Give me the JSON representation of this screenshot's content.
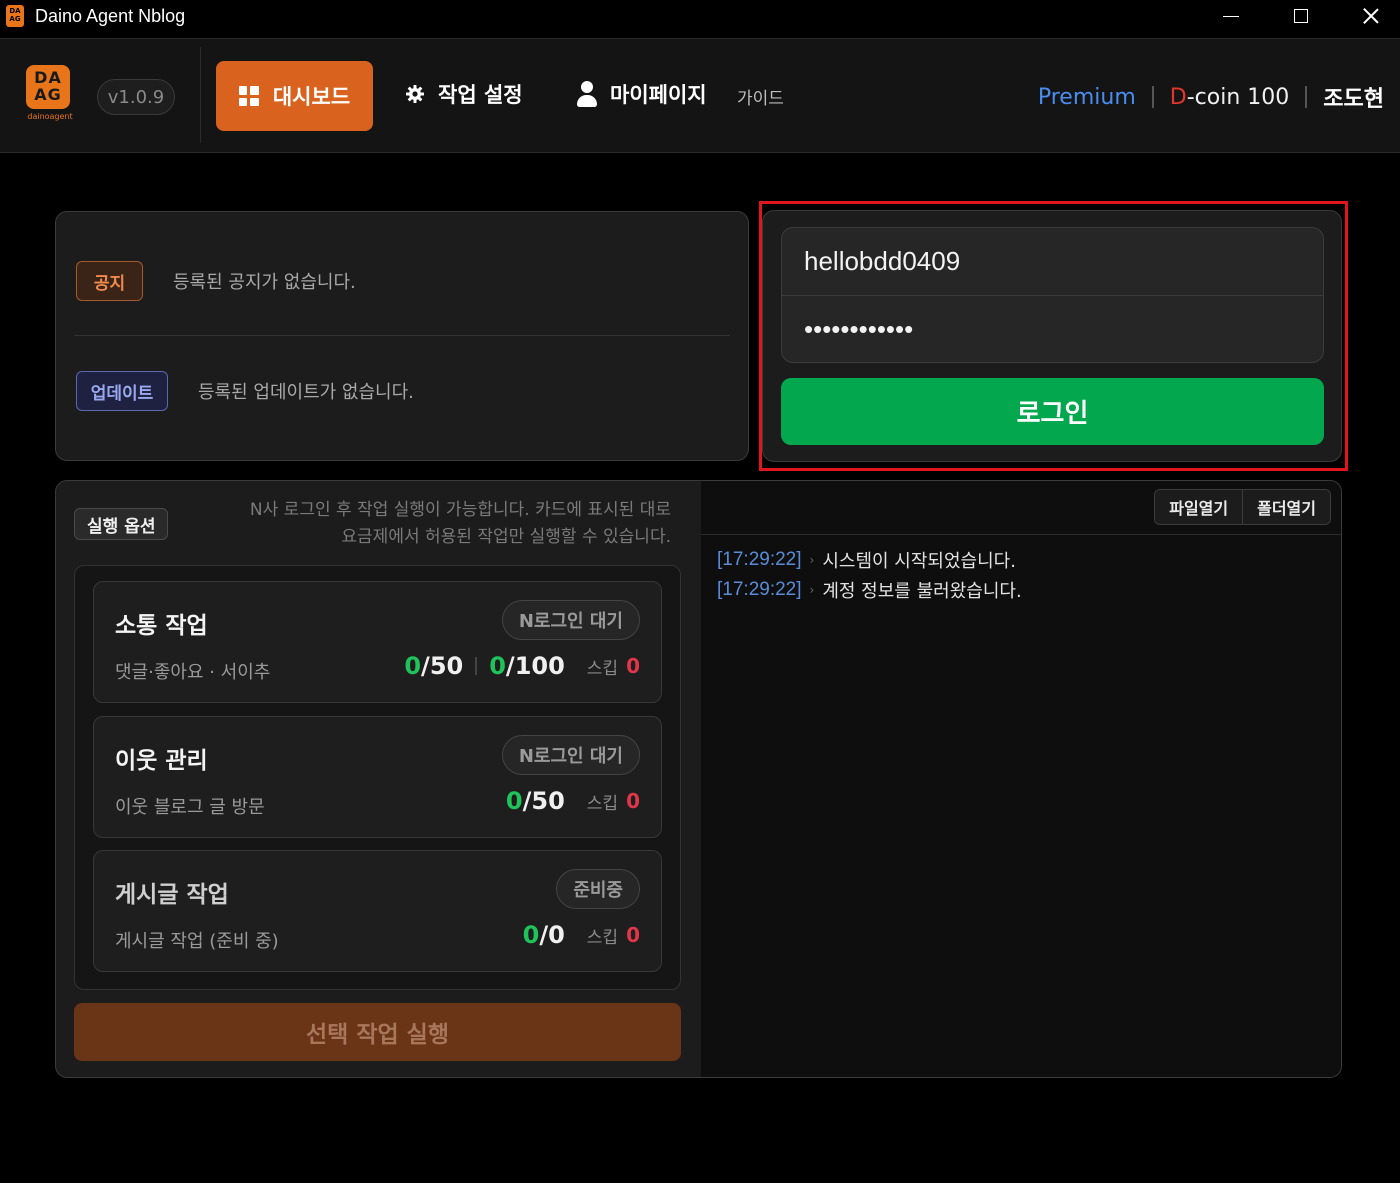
{
  "window": {
    "title": "Daino Agent Nblog"
  },
  "header": {
    "logo_text": "DA AG",
    "logo_sub": "dainoagent",
    "version": "v1.0.9",
    "nav": {
      "dashboard": "대시보드",
      "work_settings": "작업 설정",
      "mypage": "마이페이지",
      "guide": "가이드"
    },
    "plan": "Premium",
    "dcoin_d": "D",
    "dcoin_rest": "-coin 100",
    "username": "조도현"
  },
  "notices": {
    "notice_badge": "공지",
    "notice_text": "등록된 공지가 없습니다.",
    "update_badge": "업데이트",
    "update_text": "등록된 업데이트가 없습니다."
  },
  "login": {
    "username_value": "hellobdd0409",
    "password_value": "••••••••••••",
    "button": "로그인"
  },
  "run": {
    "options_badge": "실행 옵션",
    "hint_line1": "N사 로그인 후 작업 실행이 가능합니다. 카드에 표시된 대로",
    "hint_line2": "요금제에서 허용된 작업만 실행할 수 있습니다.",
    "tasks": [
      {
        "title": "소통 작업",
        "status": "N로그인 대기",
        "sub": "댓글·좋아요 · 서이추",
        "stat1_done": "0",
        "stat1_total": "/50",
        "stat2_done": "0",
        "stat2_total": "/100",
        "skip_label": "스킵",
        "skip": "0"
      },
      {
        "title": "이웃 관리",
        "status": "N로그인 대기",
        "sub": "이웃 블로그 글 방문",
        "stat1_done": "0",
        "stat1_total": "/50",
        "skip_label": "스킵",
        "skip": "0"
      },
      {
        "title": "게시글 작업",
        "status": "준비중",
        "sub": "게시글 작업 (준비 중)",
        "stat1_done": "0",
        "stat1_total": "/0",
        "skip_label": "스킵",
        "skip": "0"
      }
    ],
    "run_button": "선택 작업 실행"
  },
  "log": {
    "open_file": "파일열기",
    "open_folder": "폴더열기",
    "lines": [
      {
        "time": "[17:29:22]",
        "msg": "시스템이 시작되었습니다."
      },
      {
        "time": "[17:29:22]",
        "msg": "계정 정보를 불러왔습니다."
      }
    ]
  },
  "colors": {
    "accent": "#d9631e",
    "login_green": "#03a84e",
    "highlight_frame": "#e0161c",
    "stat_green": "#1fc35a",
    "skip_red": "#e0364a",
    "premium_blue": "#4a8cf0"
  },
  "icons": {
    "app": "app-logo-icon",
    "dashboard": "grid-icon",
    "work_settings": "gear-icon",
    "mypage": "user-icon",
    "minimize": "minimize-icon",
    "maximize": "maximize-icon",
    "close": "close-icon"
  }
}
